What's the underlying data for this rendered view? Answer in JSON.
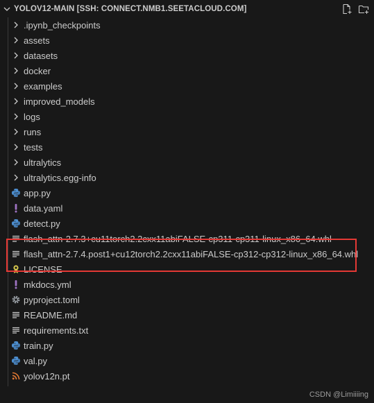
{
  "explorer": {
    "title": "YOLOV12-MAIN [SSH: CONNECT.NMB1.SEETACLOUD.COM]",
    "actions": [
      "new-file-icon",
      "new-folder-icon"
    ]
  },
  "items": [
    {
      "label": ".ipynb_checkpoints",
      "kind": "folder"
    },
    {
      "label": "assets",
      "kind": "folder"
    },
    {
      "label": "datasets",
      "kind": "folder"
    },
    {
      "label": "docker",
      "kind": "folder"
    },
    {
      "label": "examples",
      "kind": "folder"
    },
    {
      "label": "improved_models",
      "kind": "folder"
    },
    {
      "label": "logs",
      "kind": "folder"
    },
    {
      "label": "runs",
      "kind": "folder"
    },
    {
      "label": "tests",
      "kind": "folder"
    },
    {
      "label": "ultralytics",
      "kind": "folder"
    },
    {
      "label": "ultralytics.egg-info",
      "kind": "folder"
    },
    {
      "label": "app.py",
      "kind": "python"
    },
    {
      "label": "data.yaml",
      "kind": "yaml"
    },
    {
      "label": "detect.py",
      "kind": "python"
    },
    {
      "label": "flash_attn-2.7.3+cu11torch2.2cxx11abiFALSE-cp311-cp311-linux_x86_64.whl",
      "kind": "text"
    },
    {
      "label": "flash_attn-2.7.4.post1+cu12torch2.2cxx11abiFALSE-cp312-cp312-linux_x86_64.whl",
      "kind": "text"
    },
    {
      "label": "LICENSE",
      "kind": "license"
    },
    {
      "label": "mkdocs.yml",
      "kind": "yaml"
    },
    {
      "label": "pyproject.toml",
      "kind": "gear"
    },
    {
      "label": "README.md",
      "kind": "markdown"
    },
    {
      "label": "requirements.txt",
      "kind": "text"
    },
    {
      "label": "train.py",
      "kind": "python"
    },
    {
      "label": "val.py",
      "kind": "python"
    },
    {
      "label": "yolov12n.pt",
      "kind": "rss"
    }
  ],
  "colors": {
    "background": "#181818",
    "text": "#cccccc",
    "highlight_border": "#e53935",
    "python_icon": "#4d8fd1",
    "yaml_icon": "#a074c4",
    "license_icon": "#d8c84e",
    "rss_icon": "#e37933"
  },
  "watermark": "CSDN @Limiiiing"
}
